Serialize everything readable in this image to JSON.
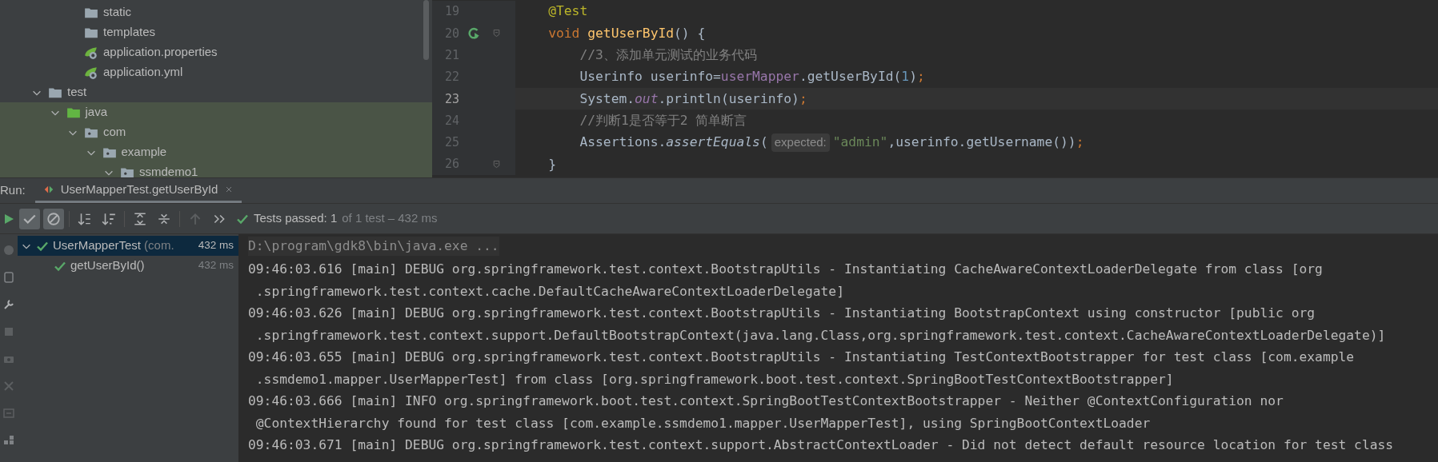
{
  "project_tree": {
    "cut_off_items": [
      {
        "label": "static",
        "kind": "folder",
        "highlighted": false
      },
      {
        "label": "templates",
        "kind": "folder",
        "highlighted": false
      },
      {
        "label": "application.properties",
        "kind": "spring-config",
        "highlighted": false
      },
      {
        "label": "application.yml",
        "kind": "spring-config",
        "highlighted": false
      }
    ],
    "items": [
      {
        "label": "test",
        "kind": "folder",
        "expanded": true,
        "highlighted": false,
        "children": [
          {
            "label": "java",
            "kind": "source-root",
            "expanded": true,
            "highlighted": true,
            "children": [
              {
                "label": "com",
                "kind": "package",
                "expanded": true,
                "highlighted": true,
                "children": [
                  {
                    "label": "example",
                    "kind": "package",
                    "expanded": true,
                    "highlighted": true,
                    "children": [
                      {
                        "label": "ssmdemo1",
                        "kind": "package",
                        "expanded": true,
                        "highlighted": true
                      }
                    ]
                  }
                ]
              }
            ]
          }
        ]
      }
    ]
  },
  "editor": {
    "lines": [
      {
        "number": "19",
        "current": false,
        "run_icon": false,
        "fold": false,
        "tokens": [
          {
            "kind": "annotation",
            "text": "    @Test"
          }
        ]
      },
      {
        "number": "20",
        "current": false,
        "run_icon": true,
        "fold": true,
        "tokens": [
          {
            "kind": "keyword",
            "text": "    void "
          },
          {
            "kind": "method",
            "text": "getUserById"
          },
          {
            "kind": "plain",
            "text": "() {"
          }
        ]
      },
      {
        "number": "21",
        "current": false,
        "run_icon": false,
        "fold": false,
        "tokens": [
          {
            "kind": "comment",
            "text": "        //3、添加单元测试的业务代码"
          }
        ]
      },
      {
        "number": "22",
        "current": false,
        "run_icon": false,
        "fold": false,
        "tokens": [
          {
            "kind": "plain",
            "text": "        Userinfo userinfo="
          },
          {
            "kind": "field",
            "text": "userMapper"
          },
          {
            "kind": "plain",
            "text": ".getUserById("
          },
          {
            "kind": "number",
            "text": "1"
          },
          {
            "kind": "plain",
            "text": ")"
          },
          {
            "kind": "keyword",
            "text": ";"
          }
        ]
      },
      {
        "number": "23",
        "current": true,
        "run_icon": false,
        "fold": false,
        "tokens": [
          {
            "kind": "plain",
            "text": "        System."
          },
          {
            "kind": "static-field",
            "text": "out"
          },
          {
            "kind": "plain",
            "text": ".println(userinfo)"
          },
          {
            "kind": "keyword",
            "text": ";"
          }
        ]
      },
      {
        "number": "24",
        "current": false,
        "run_icon": false,
        "fold": false,
        "tokens": [
          {
            "kind": "comment",
            "text": "        //判断1是否等于2 简单断言"
          }
        ]
      },
      {
        "number": "25",
        "current": false,
        "run_icon": false,
        "fold": false,
        "tokens": [
          {
            "kind": "plain",
            "text": "        Assertions."
          },
          {
            "kind": "static-method",
            "text": "assertEquals"
          },
          {
            "kind": "plain",
            "text": "("
          },
          {
            "kind": "hint",
            "text": "expected:"
          },
          {
            "kind": "string",
            "text": "\"admin\""
          },
          {
            "kind": "plain",
            "text": ",userinfo.getUsername())"
          },
          {
            "kind": "keyword",
            "text": ";"
          }
        ]
      },
      {
        "number": "26",
        "current": false,
        "run_icon": false,
        "fold": true,
        "tokens": [
          {
            "kind": "plain",
            "text": "    }"
          }
        ]
      }
    ]
  },
  "run_panel": {
    "label": "Run:",
    "tabs": [
      {
        "title": "UserMapperTest.getUserById",
        "selected": true
      }
    ],
    "toolbar": {
      "show_passed": true,
      "show_ignored": true
    },
    "status": {
      "main": "Tests passed: 1",
      "detail": "of 1 test – 432 ms"
    },
    "test_tree": [
      {
        "label": "UserMapperTest",
        "detail": "(com.",
        "time": "432 ms",
        "passed": true,
        "selected": true,
        "expanded": true,
        "children": [
          {
            "label": "getUserById()",
            "time": "432 ms",
            "passed": true,
            "selected": false
          }
        ]
      }
    ],
    "console": [
      {
        "kind": "command",
        "text": "D:\\program\\gdk8\\bin\\java.exe ..."
      },
      {
        "kind": "log",
        "text": "09:46:03.616 [main] DEBUG org.springframework.test.context.BootstrapUtils - Instantiating CacheAwareContextLoaderDelegate from class [org"
      },
      {
        "kind": "log",
        "text": " .springframework.test.context.cache.DefaultCacheAwareContextLoaderDelegate]"
      },
      {
        "kind": "log",
        "text": "09:46:03.626 [main] DEBUG org.springframework.test.context.BootstrapUtils - Instantiating BootstrapContext using constructor [public org"
      },
      {
        "kind": "log",
        "text": " .springframework.test.context.support.DefaultBootstrapContext(java.lang.Class,org.springframework.test.context.CacheAwareContextLoaderDelegate)]"
      },
      {
        "kind": "log",
        "text": "09:46:03.655 [main] DEBUG org.springframework.test.context.BootstrapUtils - Instantiating TestContextBootstrapper for test class [com.example"
      },
      {
        "kind": "log",
        "text": " .ssmdemo1.mapper.UserMapperTest] from class [org.springframework.boot.test.context.SpringBootTestContextBootstrapper]"
      },
      {
        "kind": "log",
        "text": "09:46:03.666 [main] INFO org.springframework.boot.test.context.SpringBootTestContextBootstrapper - Neither @ContextConfiguration nor"
      },
      {
        "kind": "log",
        "text": " @ContextHierarchy found for test class [com.example.ssmdemo1.mapper.UserMapperTest], using SpringBootContextLoader"
      },
      {
        "kind": "log",
        "text": "09:46:03.671 [main] DEBUG org.springframework.test.context.support.AbstractContextLoader - Did not detect default resource location for test class"
      }
    ]
  }
}
